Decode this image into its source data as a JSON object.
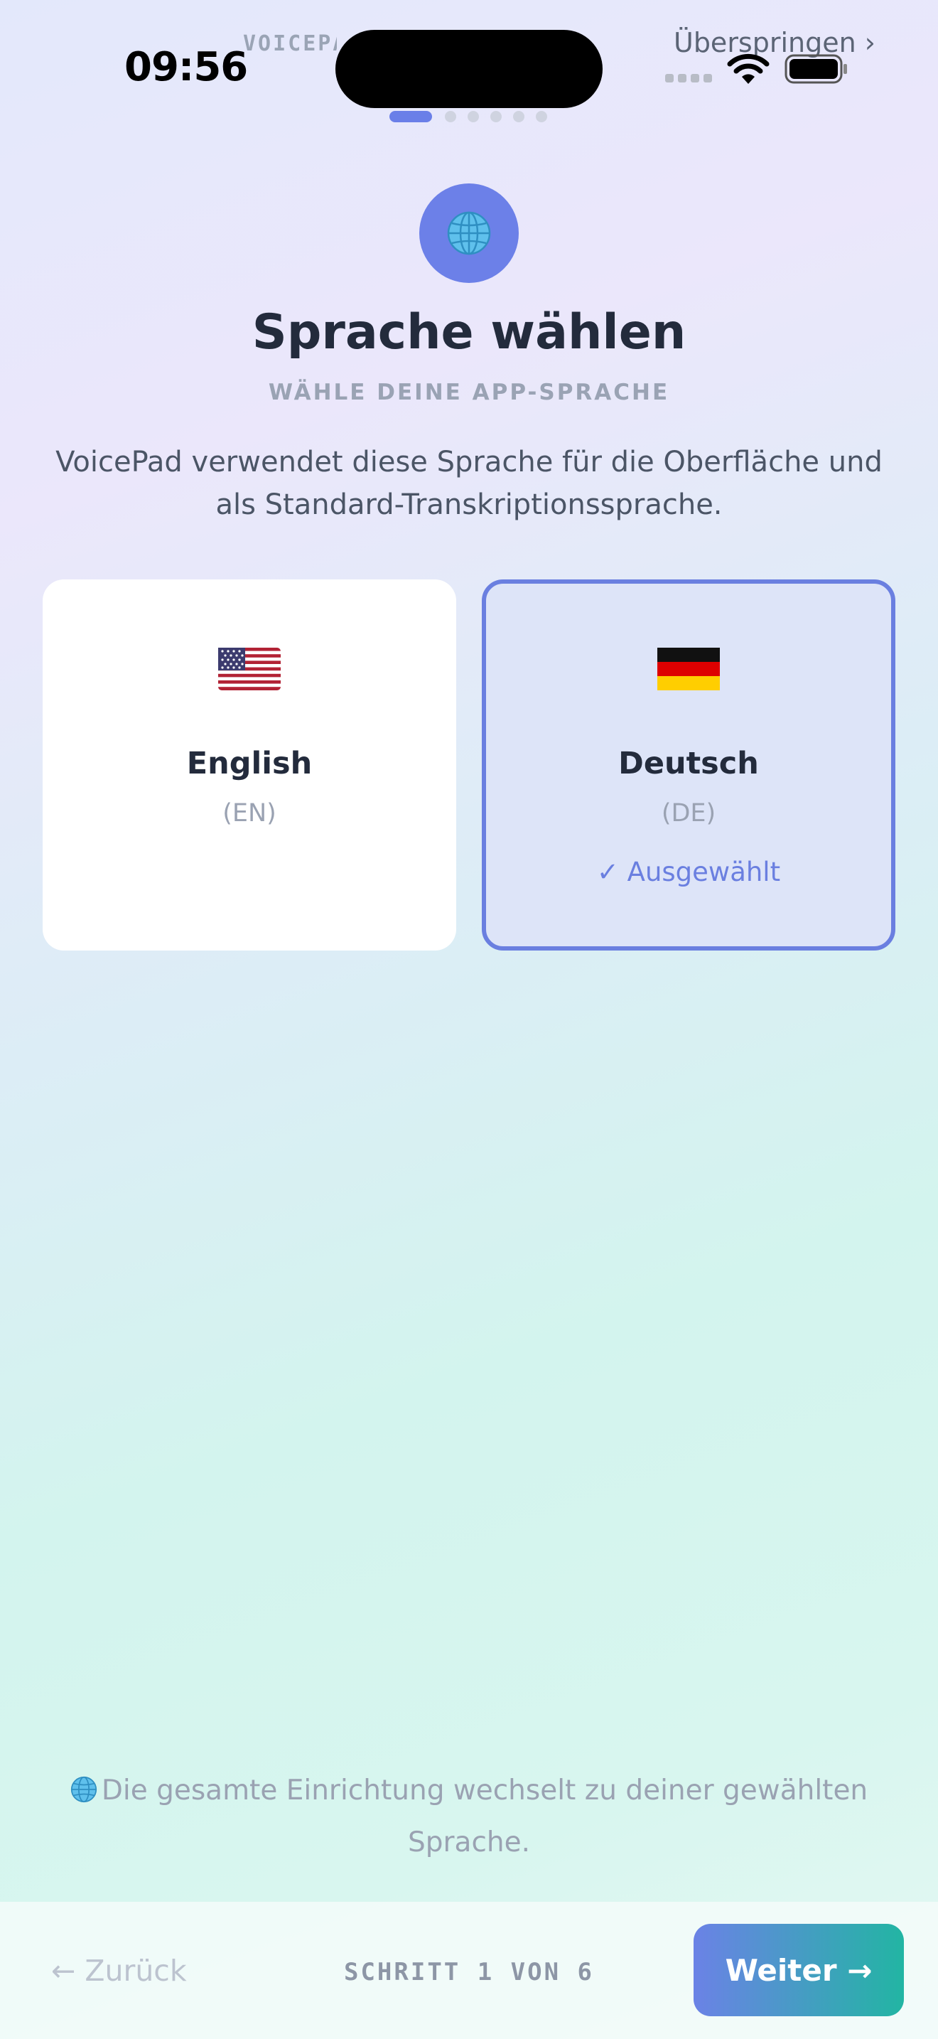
{
  "status_bar": {
    "time": "09:56",
    "brand": "VOICEPAD",
    "skip_label": "Überspringen ›"
  },
  "progress": {
    "current_step": 1,
    "total_steps": 6
  },
  "header": {
    "icon": "globe-icon",
    "title": "Sprache wählen",
    "subtitle": "WÄHLE DEINE APP-SPRACHE",
    "description": "VoicePad verwendet diese Sprache für die Oberfläche und als Standard-Transkriptionssprache."
  },
  "languages": [
    {
      "name": "English",
      "code": "(EN)",
      "flag": "us-flag-icon",
      "selected": false
    },
    {
      "name": "Deutsch",
      "code": "(DE)",
      "flag": "de-flag-icon",
      "selected": true,
      "selected_label": "✓ Ausgewählt"
    }
  ],
  "note": "Die gesamte Einrichtung wechselt zu deiner gewählten Sprache.",
  "footer": {
    "back_label": "← Zurück",
    "step_label": "SCHRITT 1 VON 6",
    "next_label": "Weiter →"
  },
  "colors": {
    "accent": "#6a7fe0",
    "title": "#232b3c",
    "muted": "#9aa2b2",
    "button_gradient_start": "#6b82e6",
    "button_gradient_end": "#22b5a3"
  }
}
